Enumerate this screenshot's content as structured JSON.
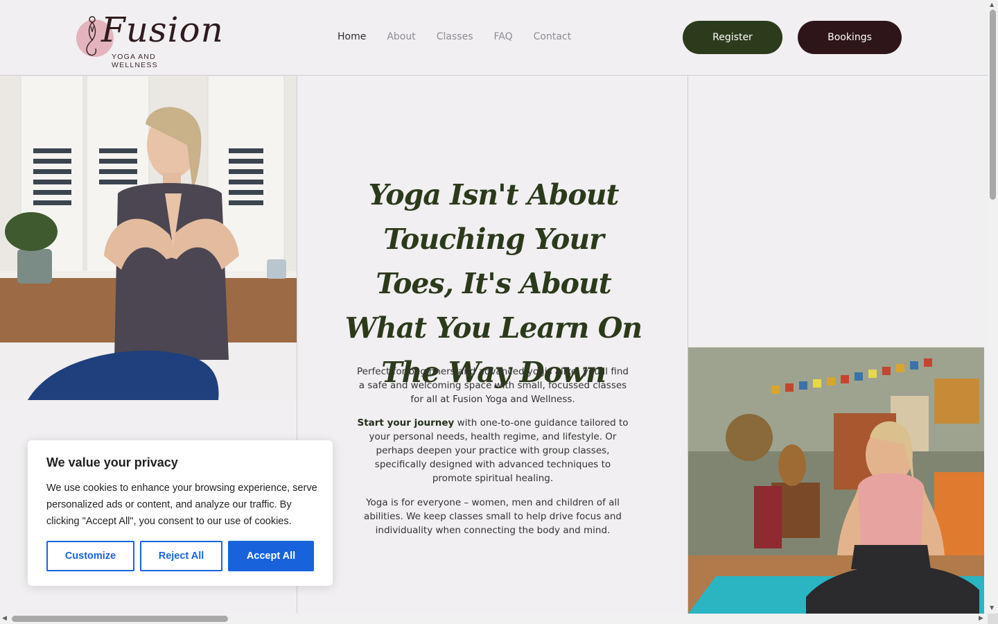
{
  "header": {
    "logo": {
      "script": "Fusion",
      "subtitle": "YOGA AND WELLNESS"
    },
    "nav": [
      {
        "label": "Home",
        "active": true
      },
      {
        "label": "About",
        "active": false
      },
      {
        "label": "Classes",
        "active": false
      },
      {
        "label": "FAQ",
        "active": false
      },
      {
        "label": "Contact",
        "active": false
      }
    ],
    "register_label": "Register",
    "bookings_label": "Bookings",
    "colors": {
      "register_bg": "#2c3b1c",
      "bookings_bg": "#2e1519",
      "logo_circle": "#e3b4bc"
    }
  },
  "hero": {
    "heading": "Yoga Isn't About Touching Your Toes, It's About What You Learn On The Way Down",
    "paragraph1": "Perfect for beginners and advanced yogis alike; you'll find a safe and welcoming space with small, focussed classes for all at Fusion Yoga and Wellness.",
    "paragraph2_strong": "Start your journey",
    "paragraph2_rest": " with one-to-one guidance tailored to your personal needs, health regime, and lifestyle. Or perhaps deepen your practice with group classes, specifically designed with advanced techniques to promote spiritual healing.",
    "paragraph3": "Yoga is for everyone – women, men and children of all abilities. We keep classes small to help drive focus and individuality when connecting the body and mind.",
    "heading_color": "#2b3a1b"
  },
  "cookie_banner": {
    "title": "We value your privacy",
    "text": "We use cookies to enhance your browsing experience, serve personalized ads or content, and analyze our traffic. By clicking \"Accept All\", you consent to our use of cookies.",
    "customize_label": "Customize",
    "reject_label": "Reject All",
    "accept_label": "Accept All",
    "accent_color": "#1863dc"
  }
}
